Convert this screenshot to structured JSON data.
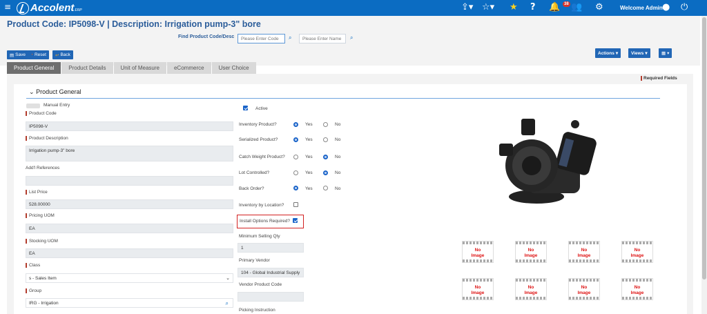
{
  "app": {
    "brand": "Accolent",
    "brand_suffix": "ERP",
    "notif_count": "38",
    "welcome": "Welcome Admin"
  },
  "header": {
    "title": "Product Code:  IP5098-V | Description: Irrigation pump-3\" bore",
    "find_label": "Find Product Code/Desc",
    "code_placeholder": "Please Enter Code",
    "name_placeholder": "Please Enter Name"
  },
  "toolbar": {
    "save": "Save",
    "reset": "Reset",
    "back": "Back",
    "actions": "Actions",
    "views": "Views"
  },
  "tabs": [
    "Product General",
    "Product Details",
    "Unit of Measure",
    "eCommerce",
    "User Choice"
  ],
  "required_fields": "Required Fields",
  "section": {
    "title": "Product General"
  },
  "left": {
    "manual_entry": "Manual Entry",
    "product_code_label": "Product Code",
    "product_code": "IP5098-V",
    "product_desc_label": "Product Description",
    "product_desc": "Irrigation pump-3\" bore",
    "addl_ref_label": "Add'l References",
    "addl_ref": "",
    "list_price_label": "List Price",
    "list_price": "528.00000",
    "pricing_uom_label": "Pricing UOM",
    "pricing_uom": "EA",
    "stocking_uom_label": "Stocking UOM",
    "stocking_uom": "EA",
    "class_label": "Class",
    "class": "s - Sales Item",
    "group_label": "Group",
    "group": "IRG - Irrigation"
  },
  "middle": {
    "active": "Active",
    "inventory_product": "Inventory Product?",
    "serialized_product": "Serialized Product?",
    "catch_weight": "Catch Weight Product?",
    "lot_controlled": "Lot Controlled?",
    "back_order": "Back Order?",
    "inv_by_location": "Inventory by Location?",
    "install_options": "Install Options Required?",
    "yes": "Yes",
    "no": "No",
    "min_qty_label": "Minimum Selling Qty",
    "min_qty": "1",
    "primary_vendor_label": "Primary Vendor",
    "primary_vendor": "104 - Global Industrial Supply",
    "vendor_code_label": "Vendor Product Code",
    "vendor_code": "",
    "picking_label": "Picking Instruction"
  },
  "images": {
    "no_image_line1": "No",
    "no_image_line2": "Image"
  },
  "colors": {
    "topbar": "#0b6cc2",
    "accent": "#2166b5",
    "required": "#b23b2b",
    "highlight": "#d21f1f"
  }
}
